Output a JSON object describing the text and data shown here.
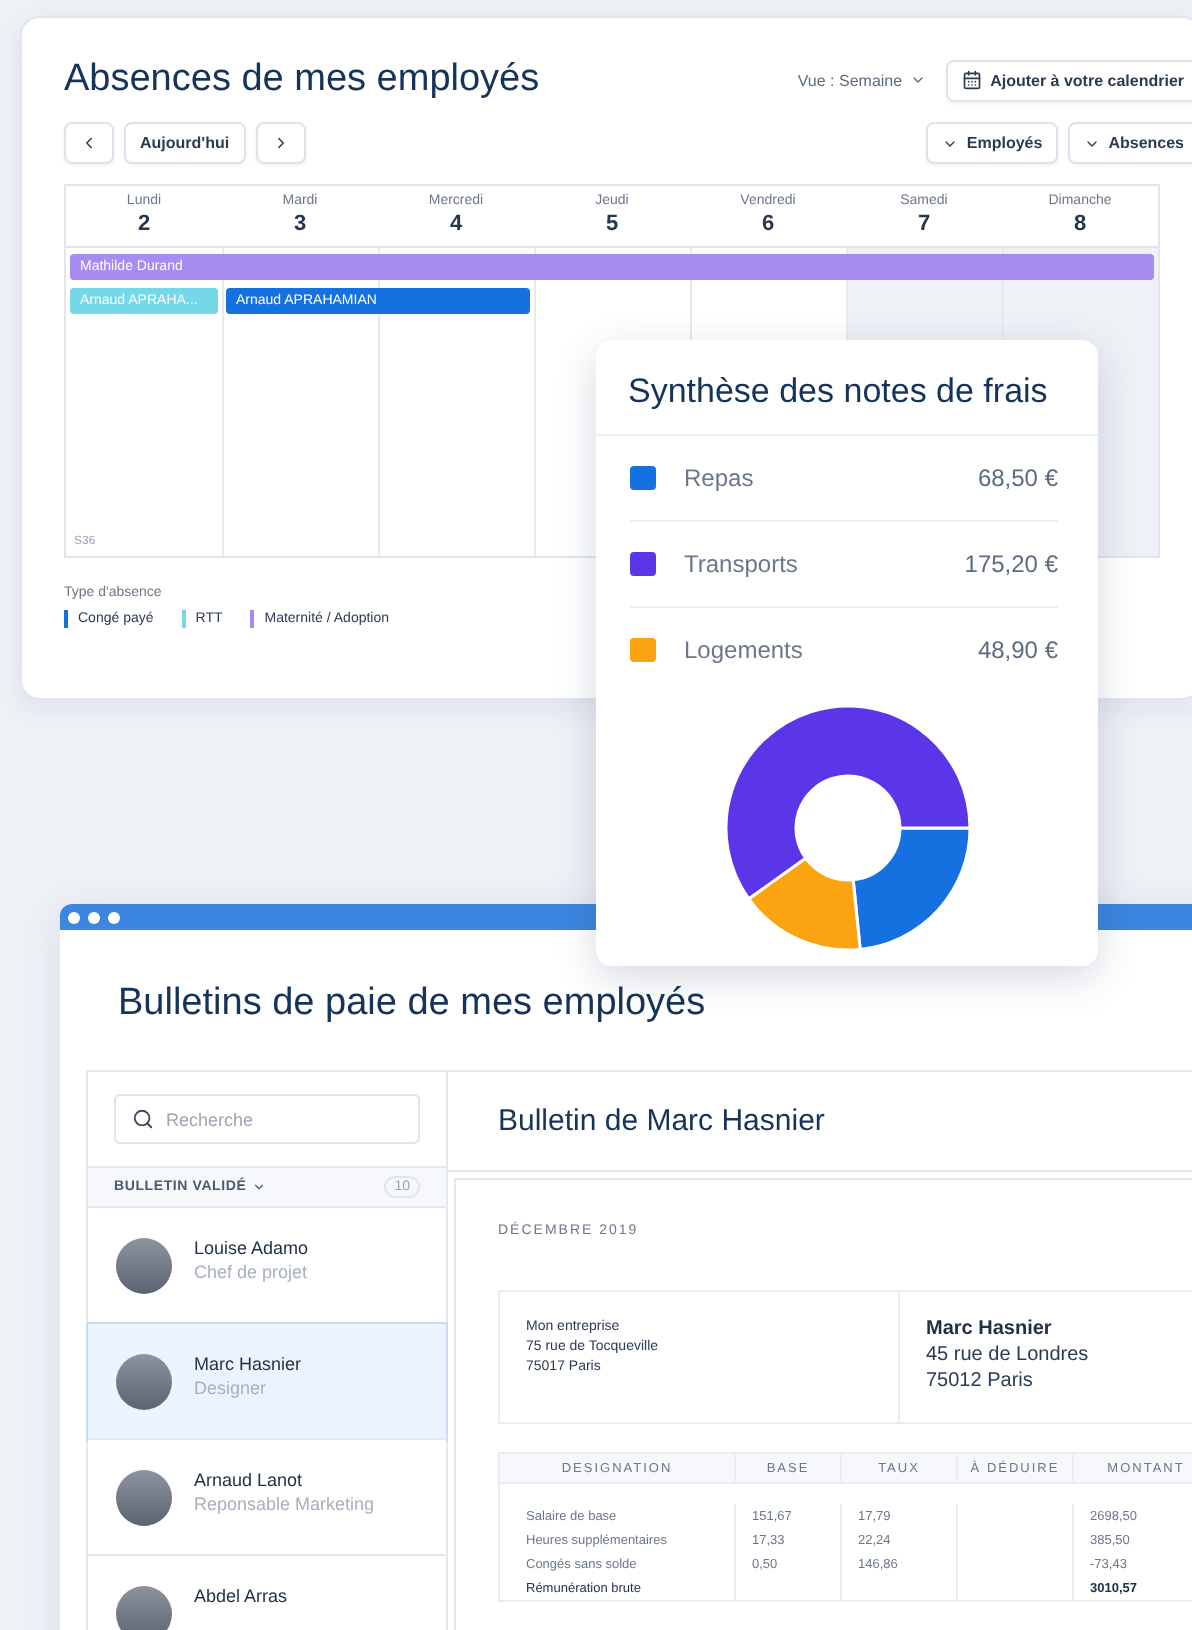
{
  "absences": {
    "title": "Absences de mes employés",
    "view_label": "Vue : Semaine",
    "add_button": "Ajouter à votre calendrier",
    "today_button": "Aujourd'hui",
    "filters": [
      "Employés",
      "Absences"
    ],
    "days": [
      {
        "name": "Lundi",
        "date": "2",
        "weekend": false
      },
      {
        "name": "Mardi",
        "date": "3",
        "weekend": false
      },
      {
        "name": "Mercredi",
        "date": "4",
        "weekend": false
      },
      {
        "name": "Jeudi",
        "date": "5",
        "weekend": false
      },
      {
        "name": "Vendredi",
        "date": "6",
        "weekend": false
      },
      {
        "name": "Samedi",
        "date": "7",
        "weekend": true
      },
      {
        "name": "Dimanche",
        "date": "8",
        "weekend": true
      }
    ],
    "events": [
      {
        "label": "Mathilde Durand",
        "color": "#a78bf0",
        "days": [
          true,
          true,
          true,
          true,
          true,
          true,
          true
        ]
      },
      {
        "label": "Arnaud APRAHA...",
        "color": "#74d8e8",
        "days": [
          true,
          false,
          false,
          false,
          false,
          false,
          false
        ]
      },
      {
        "label": "Arnaud APRAHAMIAN",
        "color": "#1570e0",
        "days": [
          false,
          true,
          true,
          false,
          false,
          false,
          false
        ]
      }
    ],
    "week": "S36",
    "legend_title": "Type d'absence",
    "legend": [
      {
        "label": "Congé payé",
        "color": "#1570e0"
      },
      {
        "label": "RTT",
        "color": "#74d8e8"
      },
      {
        "label": "Maternité / Adoption",
        "color": "#a78bf0"
      }
    ]
  },
  "expenses": {
    "title": "Synthèse des notes de frais",
    "items": [
      {
        "amount": "68,50 €",
        "color": "#1570e0"
      },
      {
        "amount": "175,20 €",
        "color": "#5b35e8"
      },
      {
        "amount": "48,90 €",
        "color": "#fca311"
      }
    ],
    "chart_data": {
      "type": "donut",
      "categories": [
        "Repas",
        "Transports",
        "Logements"
      ],
      "values": [
        23.41,
        59.88,
        16.71
      ]
    }
  },
  "payroll": {
    "title": "Bulletins de paie de mes employés",
    "search": {
      "placeholder": "Recherche"
    },
    "filter_label": "BULLETIN VALIDÉ",
    "count": "10",
    "employees": [
      {
        "name": "Louise Adamo",
        "role": "Chef de projet",
        "selected": false
      },
      {
        "name": "Marc Hasnier",
        "role": "Designer",
        "selected": true
      },
      {
        "name": "Arnaud Lanot",
        "role": "Reponsable Marketing",
        "selected": false
      },
      {
        "name": "Abdel Arras",
        "selected": false
      }
    ],
    "detail_title": "Bulletin de Marc Hasnier",
    "period": "DÉCEMBRE 2019",
    "employer": [
      "Mon entreprise",
      "75 rue de Tocqueville",
      "75017 Paris"
    ],
    "employee": {
      "name": "Marc Hasnier",
      "lines": [
        "45 rue de Londres",
        "75012 Paris"
      ]
    },
    "table": {
      "columns": [
        "DESIGNATION",
        "BASE",
        "TAUX",
        "À DÉDUIRE",
        "MONTANT"
      ],
      "rows": [
        {
          "kind": "item",
          "cells": [
            "Salaire de base",
            "151,67",
            "17,79",
            "",
            "2698,50"
          ]
        },
        {
          "kind": "item",
          "cells": [
            "Heures supplémentaires",
            "17,33",
            "22,24",
            "",
            "385,50"
          ]
        },
        {
          "kind": "item",
          "cells": [
            "Congés sans solde",
            "0,50",
            "146,86",
            "",
            "-73,43"
          ]
        },
        {
          "kind": "total",
          "cells": [
            "Rémunération brute",
            "",
            "",
            "",
            "3010,57"
          ]
        }
      ]
    }
  }
}
